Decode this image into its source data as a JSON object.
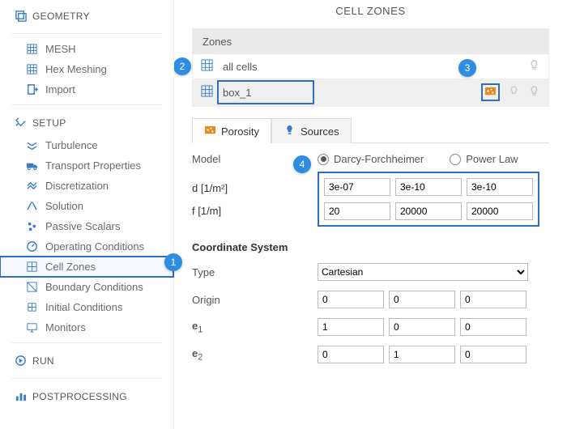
{
  "sidebar": {
    "geometry": "GEOMETRY",
    "mesh": "MESH",
    "hex": "Hex Meshing",
    "import": "Import",
    "setup": "SETUP",
    "turbulence": "Turbulence",
    "transport": "Transport Properties",
    "discretization": "Discretization",
    "solution": "Solution",
    "passive": "Passive Scalars",
    "operating": "Operating Conditions",
    "cellzones": "Cell Zones",
    "boundary": "Boundary Conditions",
    "initial": "Initial Conditions",
    "monitors": "Monitors",
    "run": "RUN",
    "postprocessing": "POSTPROCESSING"
  },
  "main": {
    "title": "CELL ZONES",
    "zones_header": "Zones",
    "zone_all": "all cells",
    "zone_box": "box_1",
    "tab_porosity": "Porosity",
    "tab_sources": "Sources",
    "model_label": "Model",
    "radio_darcy": "Darcy-Forchheimer",
    "radio_power": "Power Law",
    "d_label": "d [1/m²]",
    "d": [
      "3e-07",
      "3e-10",
      "3e-10"
    ],
    "f_label": "f [1/m]",
    "f": [
      "20",
      "20000",
      "20000"
    ],
    "coord_header": "Coordinate System",
    "type_label": "Type",
    "type_value": "Cartesian",
    "origin_label": "Origin",
    "origin": [
      "0",
      "0",
      "0"
    ],
    "e1_label_pre": "e",
    "e1_label_sub": "1",
    "e1": [
      "1",
      "0",
      "0"
    ],
    "e2_label_pre": "e",
    "e2_label_sub": "2",
    "e2": [
      "0",
      "1",
      "0"
    ]
  },
  "callouts": {
    "c1": "1",
    "c2": "2",
    "c3": "3",
    "c4": "4"
  }
}
